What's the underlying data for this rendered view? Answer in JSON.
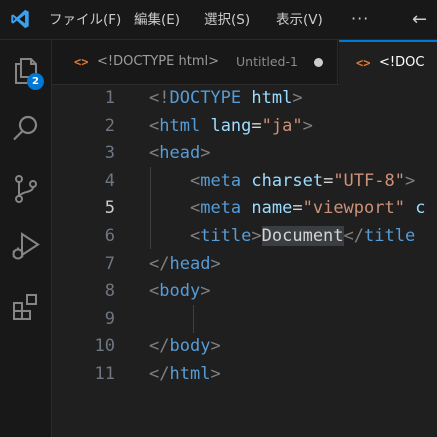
{
  "menu": [
    {
      "label": "ファイル(F)"
    },
    {
      "label": "編集(E)"
    },
    {
      "label": "選択(S)"
    },
    {
      "label": "表示(V)"
    }
  ],
  "menu_more": "···",
  "nav_back": "←",
  "activity": {
    "source_control_badge": "2"
  },
  "tabs": [
    {
      "label": "<!DOCTYPE html>",
      "description": "Untitled-1",
      "active": false,
      "dirty": true
    },
    {
      "label": "<!DOC",
      "active": true
    }
  ],
  "editor": {
    "current_line": 5,
    "line_numbers": [
      "1",
      "2",
      "3",
      "4",
      "5",
      "6",
      "7",
      "8",
      "9",
      "10",
      "11"
    ],
    "lines": [
      {
        "indent": "",
        "tokens": [
          {
            "t": "bracket",
            "v": "<!"
          },
          {
            "t": "tag",
            "v": "DOCTYPE"
          },
          {
            "t": "text",
            "v": " "
          },
          {
            "t": "attr",
            "v": "html"
          },
          {
            "t": "bracket",
            "v": ">"
          }
        ]
      },
      {
        "indent": "",
        "tokens": [
          {
            "t": "bracket",
            "v": "<"
          },
          {
            "t": "tag",
            "v": "html"
          },
          {
            "t": "text",
            "v": " "
          },
          {
            "t": "attr",
            "v": "lang"
          },
          {
            "t": "eq",
            "v": "="
          },
          {
            "t": "str",
            "v": "\"ja\""
          },
          {
            "t": "bracket",
            "v": ">"
          }
        ]
      },
      {
        "indent": "",
        "tokens": [
          {
            "t": "bracket",
            "v": "<"
          },
          {
            "t": "tag",
            "v": "head"
          },
          {
            "t": "bracket",
            "v": ">"
          }
        ]
      },
      {
        "indent": "    ",
        "tokens": [
          {
            "t": "bracket",
            "v": "<"
          },
          {
            "t": "tag",
            "v": "meta"
          },
          {
            "t": "text",
            "v": " "
          },
          {
            "t": "attr",
            "v": "charset"
          },
          {
            "t": "eq",
            "v": "="
          },
          {
            "t": "str",
            "v": "\"UTF-8\""
          },
          {
            "t": "bracket",
            "v": ">"
          }
        ]
      },
      {
        "indent": "    ",
        "tokens": [
          {
            "t": "bracket",
            "v": "<"
          },
          {
            "t": "tag",
            "v": "meta"
          },
          {
            "t": "text",
            "v": " "
          },
          {
            "t": "attr",
            "v": "name"
          },
          {
            "t": "eq",
            "v": "="
          },
          {
            "t": "str",
            "v": "\"viewport\""
          },
          {
            "t": "text",
            "v": " "
          },
          {
            "t": "attr",
            "v": "c"
          }
        ]
      },
      {
        "indent": "    ",
        "tokens": [
          {
            "t": "bracket",
            "v": "<"
          },
          {
            "t": "tag",
            "v": "title"
          },
          {
            "t": "bracket",
            "v": ">"
          },
          {
            "t": "text",
            "v": "Document",
            "hl": true
          },
          {
            "t": "bracket",
            "v": "</"
          },
          {
            "t": "tag",
            "v": "title"
          }
        ]
      },
      {
        "indent": "",
        "tokens": [
          {
            "t": "bracket",
            "v": "</"
          },
          {
            "t": "tag",
            "v": "head"
          },
          {
            "t": "bracket",
            "v": ">"
          }
        ]
      },
      {
        "indent": "",
        "tokens": [
          {
            "t": "bracket",
            "v": "<"
          },
          {
            "t": "tag",
            "v": "body"
          },
          {
            "t": "bracket",
            "v": ">"
          }
        ]
      },
      {
        "indent": "",
        "tokens": []
      },
      {
        "indent": "",
        "tokens": [
          {
            "t": "bracket",
            "v": "</"
          },
          {
            "t": "tag",
            "v": "body"
          },
          {
            "t": "bracket",
            "v": ">"
          }
        ]
      },
      {
        "indent": "",
        "tokens": [
          {
            "t": "bracket",
            "v": "</"
          },
          {
            "t": "tag",
            "v": "html"
          },
          {
            "t": "bracket",
            "v": ">"
          }
        ]
      }
    ]
  },
  "colors": {
    "accent": "#0078d4",
    "html_icon": "#e37933",
    "tag": "#569cd6",
    "attribute": "#9cdcfe",
    "string": "#ce9178",
    "bracket": "#808080",
    "text": "#d4d4d4"
  }
}
